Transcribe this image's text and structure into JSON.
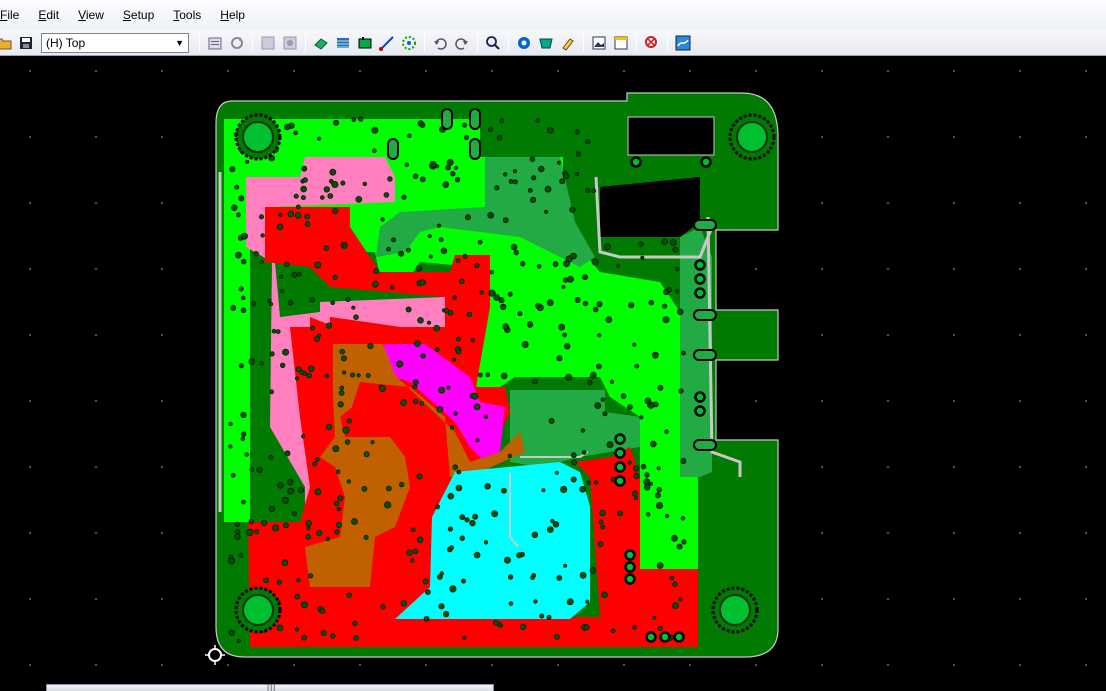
{
  "menu": {
    "items": [
      {
        "prefix": "",
        "mnemonic": "F",
        "rest": "ile"
      },
      {
        "prefix": "",
        "mnemonic": "E",
        "rest": "dit"
      },
      {
        "prefix": "",
        "mnemonic": "V",
        "rest": "iew"
      },
      {
        "prefix": "",
        "mnemonic": "S",
        "rest": "etup"
      },
      {
        "prefix": "",
        "mnemonic": "T",
        "rest": "ools"
      },
      {
        "prefix": "",
        "mnemonic": "H",
        "rest": "elp"
      }
    ]
  },
  "toolbar": {
    "layer_value": "(H) Top"
  },
  "scrollbar": {
    "grip": "|||"
  },
  "colors": {
    "board_green": "#007a00",
    "bright_green": "#00ff00",
    "red": "#ff0000",
    "pink": "#ff7fbf",
    "magenta": "#ff00ff",
    "brown": "#c06000",
    "cyan": "#00ffff",
    "mid_green": "#22aa44",
    "outline": "#c8c8c8"
  }
}
